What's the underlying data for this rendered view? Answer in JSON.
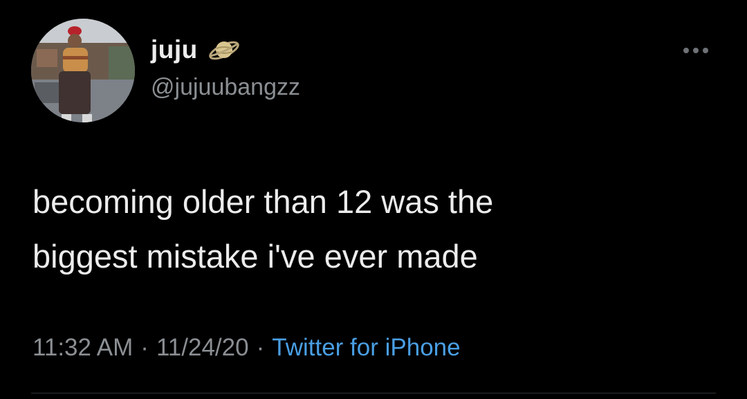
{
  "tweet": {
    "author": {
      "display_name": "juju",
      "handle": "@jujuubangzz",
      "name_emoji_icon": "ringed-planet-icon"
    },
    "text_lines": [
      "becoming older than 12 was the",
      "biggest mistake i've ever made"
    ],
    "meta": {
      "time": "11:32 AM",
      "separator": "·",
      "date": "11/24/20",
      "source": "Twitter for iPhone"
    },
    "more_icon": "more-options-icon"
  },
  "colors": {
    "background": "#000000",
    "text": "#ececec",
    "secondary": "#8b8f93",
    "link": "#4a9fe4"
  }
}
